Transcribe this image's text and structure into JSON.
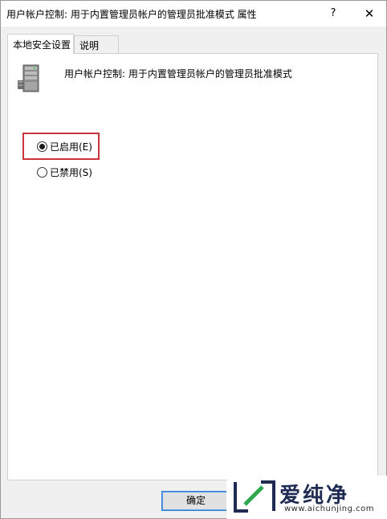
{
  "window": {
    "title": "用户帐户控制: 用于内置管理员帐户的管理员批准模式 属性",
    "help_glyph": "?",
    "close_glyph": "✕"
  },
  "tabs": [
    {
      "label": "本地安全设置",
      "active": true
    },
    {
      "label": "说明",
      "active": false
    }
  ],
  "policy": {
    "icon": "server-icon",
    "title": "用户帐户控制: 用于内置管理员帐户的管理员批准模式"
  },
  "options": [
    {
      "label": "已启用(E)",
      "checked": true
    },
    {
      "label": "已禁用(S)",
      "checked": false
    }
  ],
  "buttons": {
    "ok_label": "确定"
  },
  "watermark": {
    "name": "爱纯净",
    "url": "www.aichunjing.com"
  },
  "colors": {
    "highlight": "#c9343e",
    "button_border": "#2f7fd6",
    "watermark_text": "#1f2b52"
  }
}
